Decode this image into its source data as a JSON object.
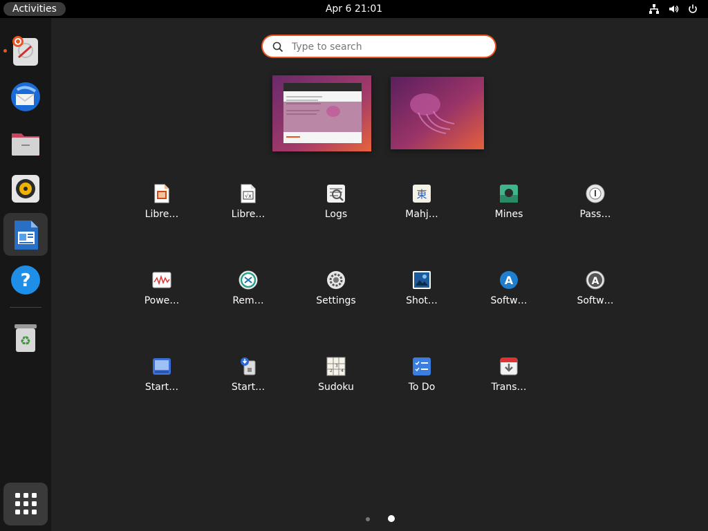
{
  "topbar": {
    "activities": "Activities",
    "clock": "Apr 6  21:01",
    "tray_icons": [
      "network-icon",
      "volume-icon",
      "power-icon"
    ]
  },
  "dock": {
    "items": [
      {
        "name": "help-ubuntu",
        "icon": "lifebuoy-icon",
        "running": true
      },
      {
        "name": "thunderbird",
        "icon": "thunderbird-icon"
      },
      {
        "name": "files",
        "icon": "folder-icon"
      },
      {
        "name": "rhythmbox",
        "icon": "speaker-icon"
      },
      {
        "name": "libreoffice-writer",
        "icon": "writer-icon",
        "active": true
      },
      {
        "name": "help",
        "icon": "help-icon"
      },
      {
        "name": "trash",
        "icon": "trash-icon"
      }
    ],
    "show_apps_icon": "app-grid-icon"
  },
  "search": {
    "placeholder": "Type to search",
    "value": ""
  },
  "apps": [
    {
      "label": "Libre…",
      "icon": "libreoffice-impress-icon"
    },
    {
      "label": "Libre…",
      "icon": "libreoffice-math-icon"
    },
    {
      "label": "Logs",
      "icon": "logs-icon"
    },
    {
      "label": "Mahj…",
      "icon": "mahjongg-icon"
    },
    {
      "label": "Mines",
      "icon": "mines-icon"
    },
    {
      "label": "Pass…",
      "icon": "passwords-icon"
    },
    {
      "label": "Powe…",
      "icon": "power-statistics-icon"
    },
    {
      "label": "Rem…",
      "icon": "remmina-icon"
    },
    {
      "label": "Settings",
      "icon": "settings-icon"
    },
    {
      "label": "Shot…",
      "icon": "shotwell-icon"
    },
    {
      "label": "Softw…",
      "icon": "software-icon"
    },
    {
      "label": "Softw…",
      "icon": "software-updater-icon"
    },
    {
      "label": "Start…",
      "icon": "startup-disk-creator-icon"
    },
    {
      "label": "Start…",
      "icon": "startup-applications-icon"
    },
    {
      "label": "Sudoku",
      "icon": "sudoku-icon"
    },
    {
      "label": "To Do",
      "icon": "todo-icon"
    },
    {
      "label": "Trans…",
      "icon": "transmission-icon"
    }
  ],
  "pager": {
    "pages": 2,
    "current": 2
  },
  "colors": {
    "accent": "#e95420",
    "background": "#222222",
    "topbar": "#000000",
    "dock": "#171717"
  }
}
